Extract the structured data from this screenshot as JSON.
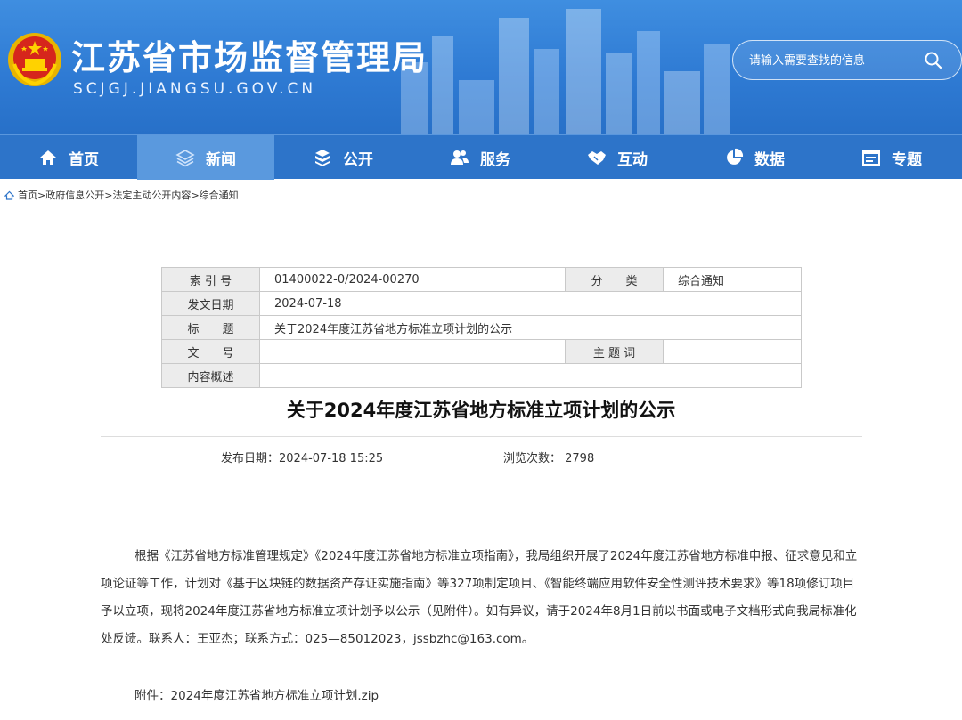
{
  "header": {
    "title": "江苏省市场监督管理局",
    "domain": "SCJGJ.JIANGSU.GOV.CN",
    "search_placeholder": "请输入需要查找的信息"
  },
  "nav": {
    "items": [
      {
        "label": "首页",
        "icon": "home-icon"
      },
      {
        "label": "新闻",
        "icon": "layers-icon"
      },
      {
        "label": "公开",
        "icon": "cube-icon"
      },
      {
        "label": "服务",
        "icon": "users-icon"
      },
      {
        "label": "互动",
        "icon": "handshake-icon"
      },
      {
        "label": "数据",
        "icon": "pie-chart-icon"
      },
      {
        "label": "专题",
        "icon": "window-icon"
      }
    ],
    "active": "新闻"
  },
  "breadcrumb": {
    "items": [
      "首页",
      "政府信息公开",
      "法定主动公开内容",
      "综合通知"
    ],
    "separator": ">"
  },
  "info_table": {
    "index_label": "索 引 号",
    "index_value": "01400022-0/2024-00270",
    "category_label": "分　　类",
    "category_value": "综合通知",
    "date_label": "发文日期",
    "date_value": "2024-07-18",
    "title_label": "标　　题",
    "title_value": "关于2024年度江苏省地方标准立项计划的公示",
    "docno_label": "文　　号",
    "docno_value": "",
    "keyword_label": "主 题 词",
    "keyword_value": "",
    "summary_label": "内容概述",
    "summary_value": ""
  },
  "article": {
    "title": "关于2024年度江苏省地方标准立项计划的公示",
    "publish_date": "发布日期：2024-07-18 15:25",
    "views": "浏览次数：  2798",
    "body": "根据《江苏省地方标准管理规定》《2024年度江苏省地方标准立项指南》，我局组织开展了2024年度江苏省地方标准申报、征求意见和立项论证等工作，计划对《基于区块链的数据资产存证实施指南》等327项制定项目、《智能终端应用软件安全性测评技术要求》等18项修订项目予以立项，现将2024年度江苏省地方标准立项计划予以公示（见附件）。如有异议，请于2024年8月1日前以书面或电子文档形式向我局标准化处反馈。联系人：王亚杰；联系方式：025—85012023，jssbzhc@163.com。",
    "attachment": "附件：2024年度江苏省地方标准立项计划.zip"
  },
  "colors": {
    "header_blue": "#2f7bd4",
    "nav_blue": "#2d74c9",
    "nav_active": "#5a99de",
    "table_label_bg": "#ececec"
  }
}
